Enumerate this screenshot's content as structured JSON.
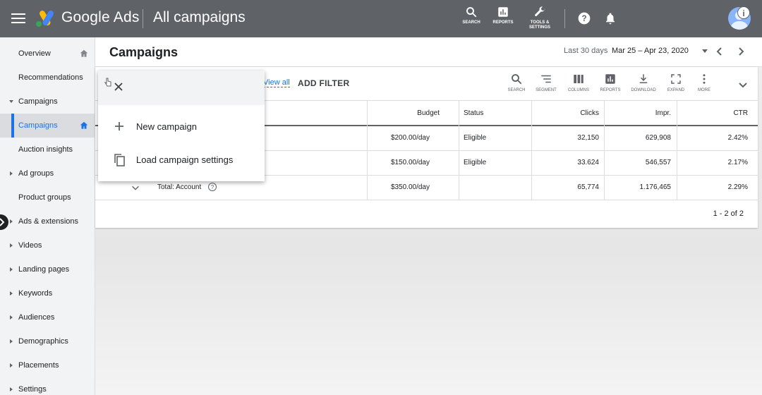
{
  "app": {
    "brand": "Google Ads",
    "page_name": "All campaigns"
  },
  "top_tools": [
    {
      "label": "SEARCH",
      "icon": "search-icon"
    },
    {
      "label": "REPORTS",
      "icon": "reports-icon"
    },
    {
      "label": "TOOLS & SETTINGS",
      "icon": "wrench-icon"
    }
  ],
  "sidebar": {
    "items": [
      {
        "label": "Overview"
      },
      {
        "label": "Recommendations"
      },
      {
        "label": "Campaigns"
      },
      {
        "label": "Campaigns"
      },
      {
        "label": "Auction insights"
      },
      {
        "label": "Ad groups"
      },
      {
        "label": "Product groups"
      },
      {
        "label": "Ads & extensions"
      },
      {
        "label": "Videos"
      },
      {
        "label": "Landing pages"
      },
      {
        "label": "Keywords"
      },
      {
        "label": "Audiences"
      },
      {
        "label": "Demographics"
      },
      {
        "label": "Placements"
      },
      {
        "label": "Settings"
      }
    ]
  },
  "header": {
    "title": "Campaigns",
    "range_label": "Last 30 days",
    "date_range": "Mar 25 – Apr 23, 2020"
  },
  "toolbar": {
    "view_all": "View all",
    "add_filter": "ADD FILTER",
    "tools": [
      "SEARCH",
      "SEGMENT",
      "COLUMNS",
      "REPORTS",
      "DOWNLOAD",
      "EXPAND",
      "MORE"
    ]
  },
  "table": {
    "columns": [
      "Budget",
      "Status",
      "Clicks",
      "Impr.",
      "CTR"
    ],
    "rows": [
      {
        "budget": "$200.00/day",
        "status": "Eligible",
        "clicks": "32,150",
        "impr": "629,908",
        "ctr": "2.42%"
      },
      {
        "budget": "$150.00/day",
        "status": "Eligible",
        "clicks": "33.624",
        "impr": "546,557",
        "ctr": "2.17%"
      }
    ],
    "total": {
      "label": "Total: Account",
      "budget": "$350.00/day",
      "status": "",
      "clicks": "65,774",
      "impr": "1.176,465",
      "ctr": "2.29%"
    },
    "pagination": "1 - 2 of 2"
  },
  "menu": {
    "items": [
      {
        "label": "New campaign",
        "icon": "plus-icon"
      },
      {
        "label": "Load campaign settings",
        "icon": "copy-icon"
      }
    ]
  },
  "colors": {
    "topbar": "#5f6368",
    "accent": "#1a73e8"
  }
}
